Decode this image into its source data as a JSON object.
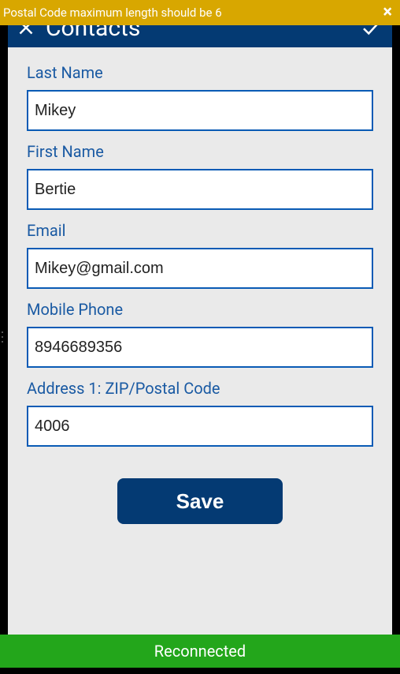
{
  "toast": {
    "message": "Postal Code maximum length should be 6"
  },
  "header": {
    "title": "Contacts"
  },
  "fields": {
    "last_name": {
      "label": "Last Name",
      "value": "Mikey"
    },
    "first_name": {
      "label": "First Name",
      "value": "Bertie"
    },
    "email": {
      "label": "Email",
      "value": "Mikey@gmail.com"
    },
    "mobile_phone": {
      "label": "Mobile Phone",
      "value": "8946689356"
    },
    "postal_code": {
      "label": "Address 1: ZIP/Postal Code",
      "value": "4006"
    }
  },
  "buttons": {
    "save": "Save"
  },
  "status": {
    "reconnected": "Reconnected"
  }
}
